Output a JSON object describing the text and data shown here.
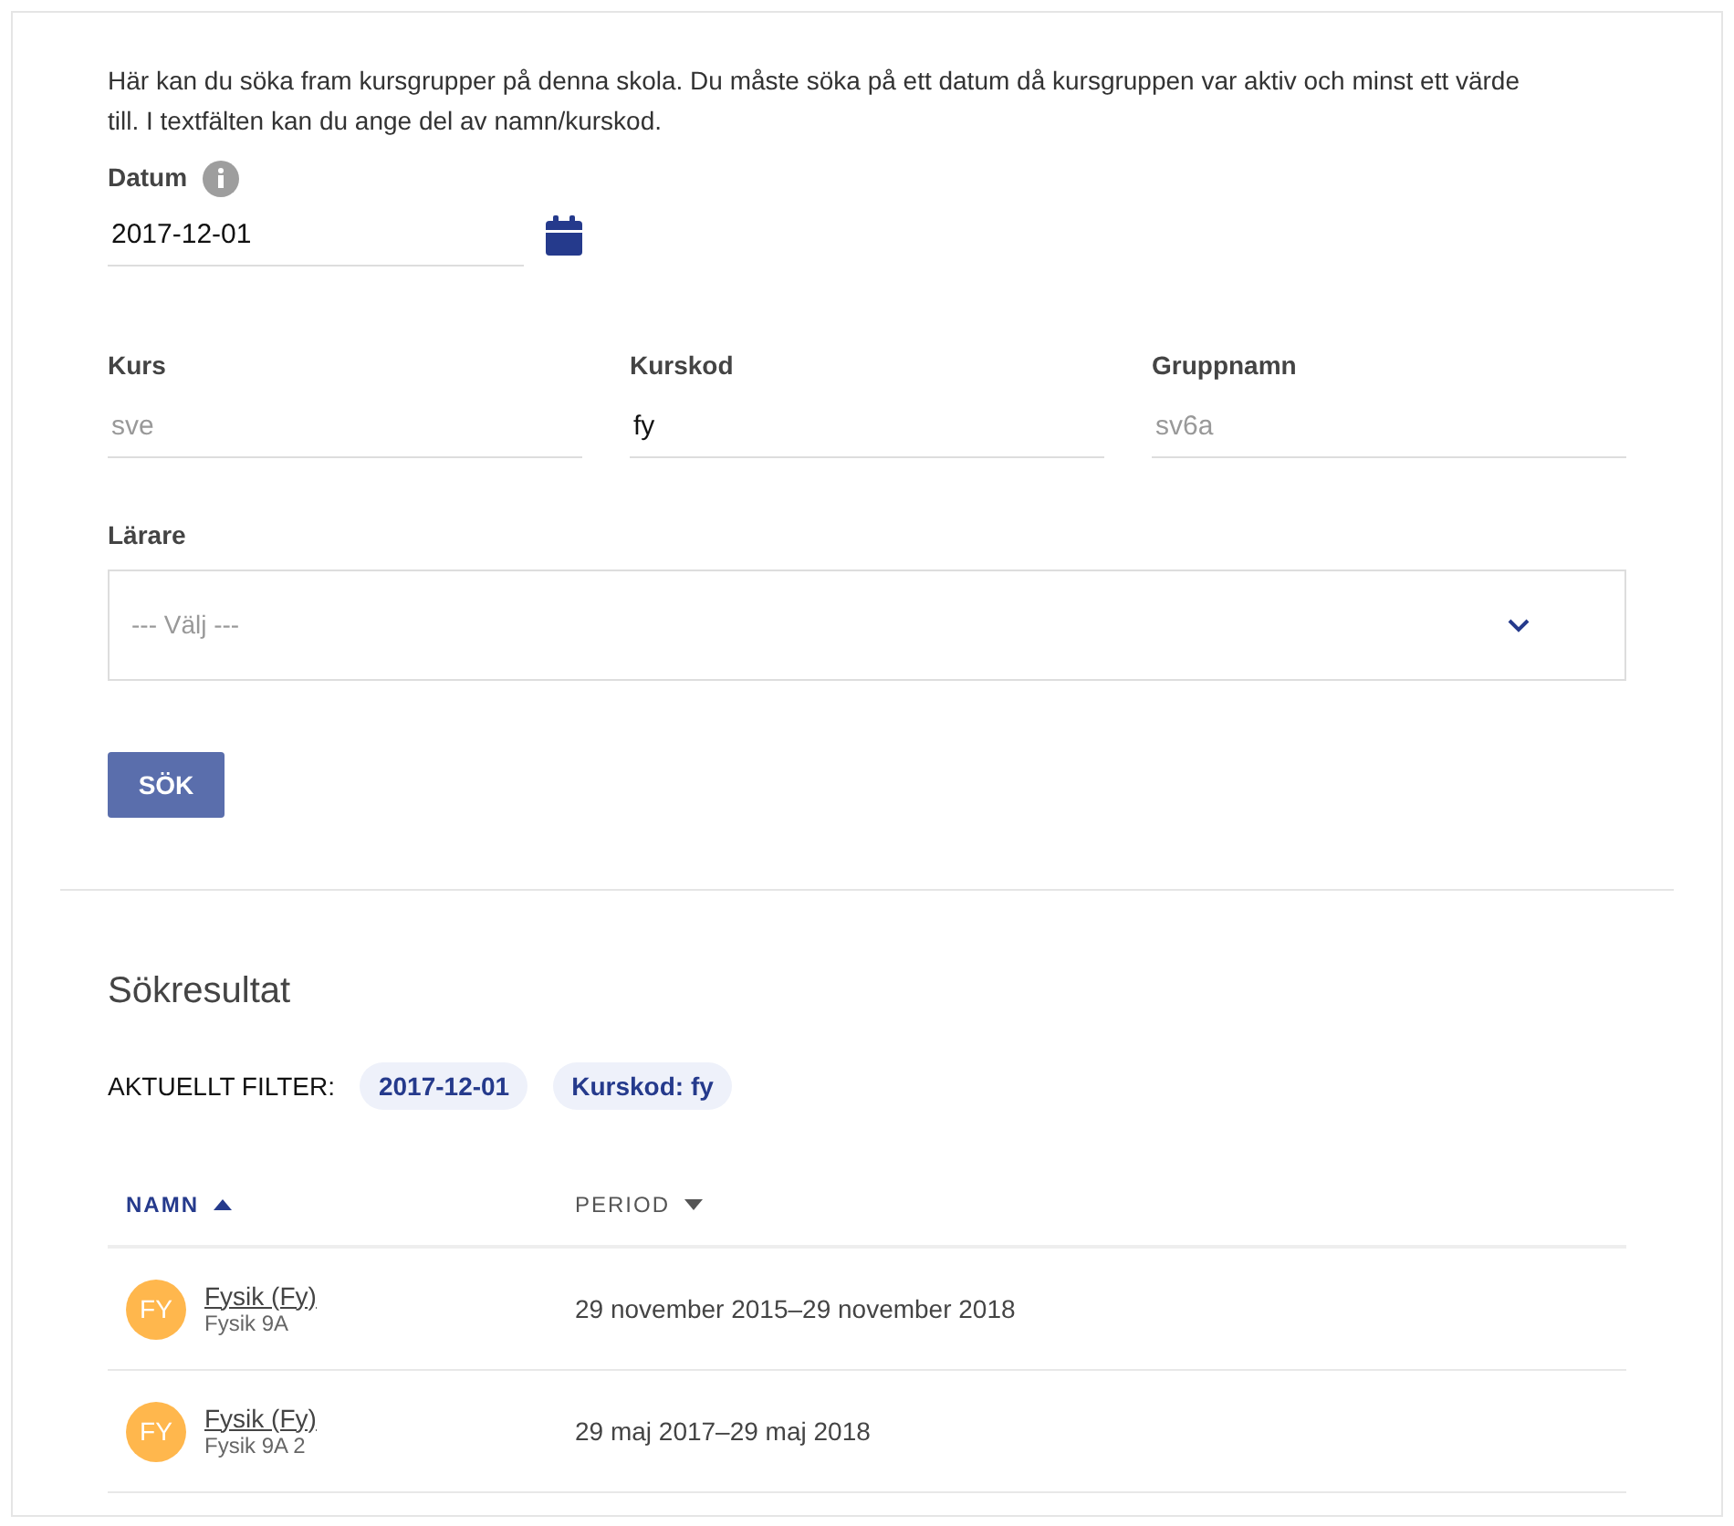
{
  "intro": "Här kan du söka fram kursgrupper på denna skola. Du måste söka på ett datum då kursgruppen var aktiv och minst ett värde till. I textfälten kan du ange del av namn/kurskod.",
  "date_field": {
    "label": "Datum",
    "value": "2017-12-01"
  },
  "fields": [
    {
      "label": "Kurs",
      "placeholder": "sve"
    },
    {
      "label": "Kurskod",
      "value": "fy"
    },
    {
      "label": "Gruppnamn",
      "placeholder": "sv6a"
    }
  ],
  "teacher_select": {
    "label": "Lärare",
    "placeholder": "--- Välj ---"
  },
  "search_button": "SÖK",
  "results": {
    "title": "Sökresultat",
    "filter_label": "AKTUELLT FILTER:",
    "filters": [
      "2017-12-01",
      "Kurskod: fy"
    ],
    "columns": [
      {
        "label": "NAMN",
        "selected": true,
        "ascending": true
      },
      {
        "label": "PERIOD",
        "selected": false,
        "ascending": false
      }
    ],
    "rows": [
      {
        "initials": "FY",
        "name": "Fysik (Fy)",
        "group": "Fysik 9A",
        "period": "29 november 2015–29 november 2018"
      },
      {
        "initials": "FY",
        "name": "Fysik (Fy)",
        "group": "Fysik 9A 2",
        "period": "29 maj 2017–29 maj 2018"
      }
    ]
  }
}
